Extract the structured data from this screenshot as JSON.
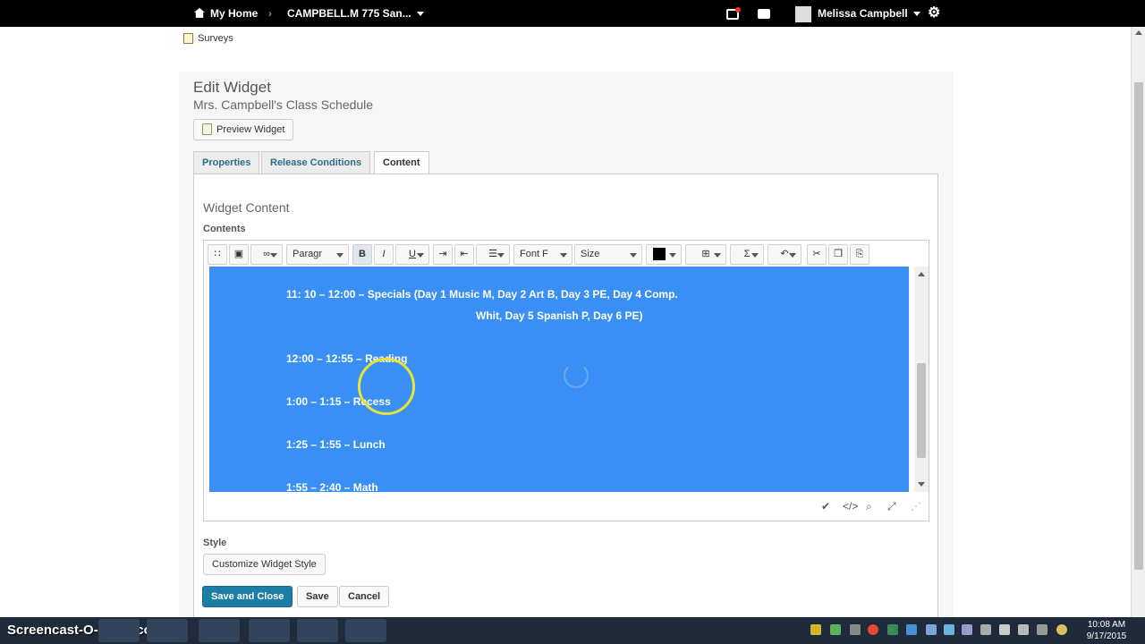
{
  "topbar": {
    "home_label": "My Home",
    "course_label": "CAMPBELL.M 775 San...",
    "user_name": "Melissa Campbell",
    "icons": [
      "home-icon",
      "alerts-icon",
      "messages-icon",
      "avatar",
      "gear-icon"
    ]
  },
  "breadcrumb": {
    "surveys_label": "Surveys"
  },
  "page": {
    "title": "Edit Widget",
    "subtitle": "Mrs. Campbell's Class Schedule",
    "preview_label": "Preview Widget",
    "tabs": [
      {
        "label": "Properties"
      },
      {
        "label": "Release Conditions"
      },
      {
        "label": "Content"
      }
    ],
    "active_tab": "Content",
    "widget_content_heading": "Widget Content",
    "contents_label": "Contents"
  },
  "editor": {
    "toolbar": {
      "paragraph_label": "Paragr",
      "font_family_label": "Font F",
      "size_label": "Size",
      "bold_label": "B",
      "italic_label": "I",
      "underline_label": "U",
      "sigma_label": "Σ",
      "text_color": "#000000"
    },
    "lines": [
      "11: 10 – 12:00 – Specials (Day 1 Music M, Day 2 Art B, Day 3 PE, Day 4 Comp.",
      "Whit, Day 5 Spanish P, Day 6 PE)",
      "12:00 – 12:55 – Reading",
      "1:00 – 1:15 – Recess",
      "1:25 – 1:55 – Lunch",
      "1:55 – 2:40 – Math"
    ],
    "selection_color": "#3a8ff4"
  },
  "style_section": {
    "label": "Style",
    "customize_label": "Customize Widget Style"
  },
  "actions": {
    "save_close_label": "Save and Close",
    "save_label": "Save",
    "cancel_label": "Cancel"
  },
  "taskbar": {
    "watermark": "Screencast-O-Matic.com",
    "time": "10:08 AM",
    "date": "9/17/2015"
  },
  "colors": {
    "accent": "#1c7ea5",
    "tab_link": "#2c6e8a",
    "topbar": "#000000"
  }
}
